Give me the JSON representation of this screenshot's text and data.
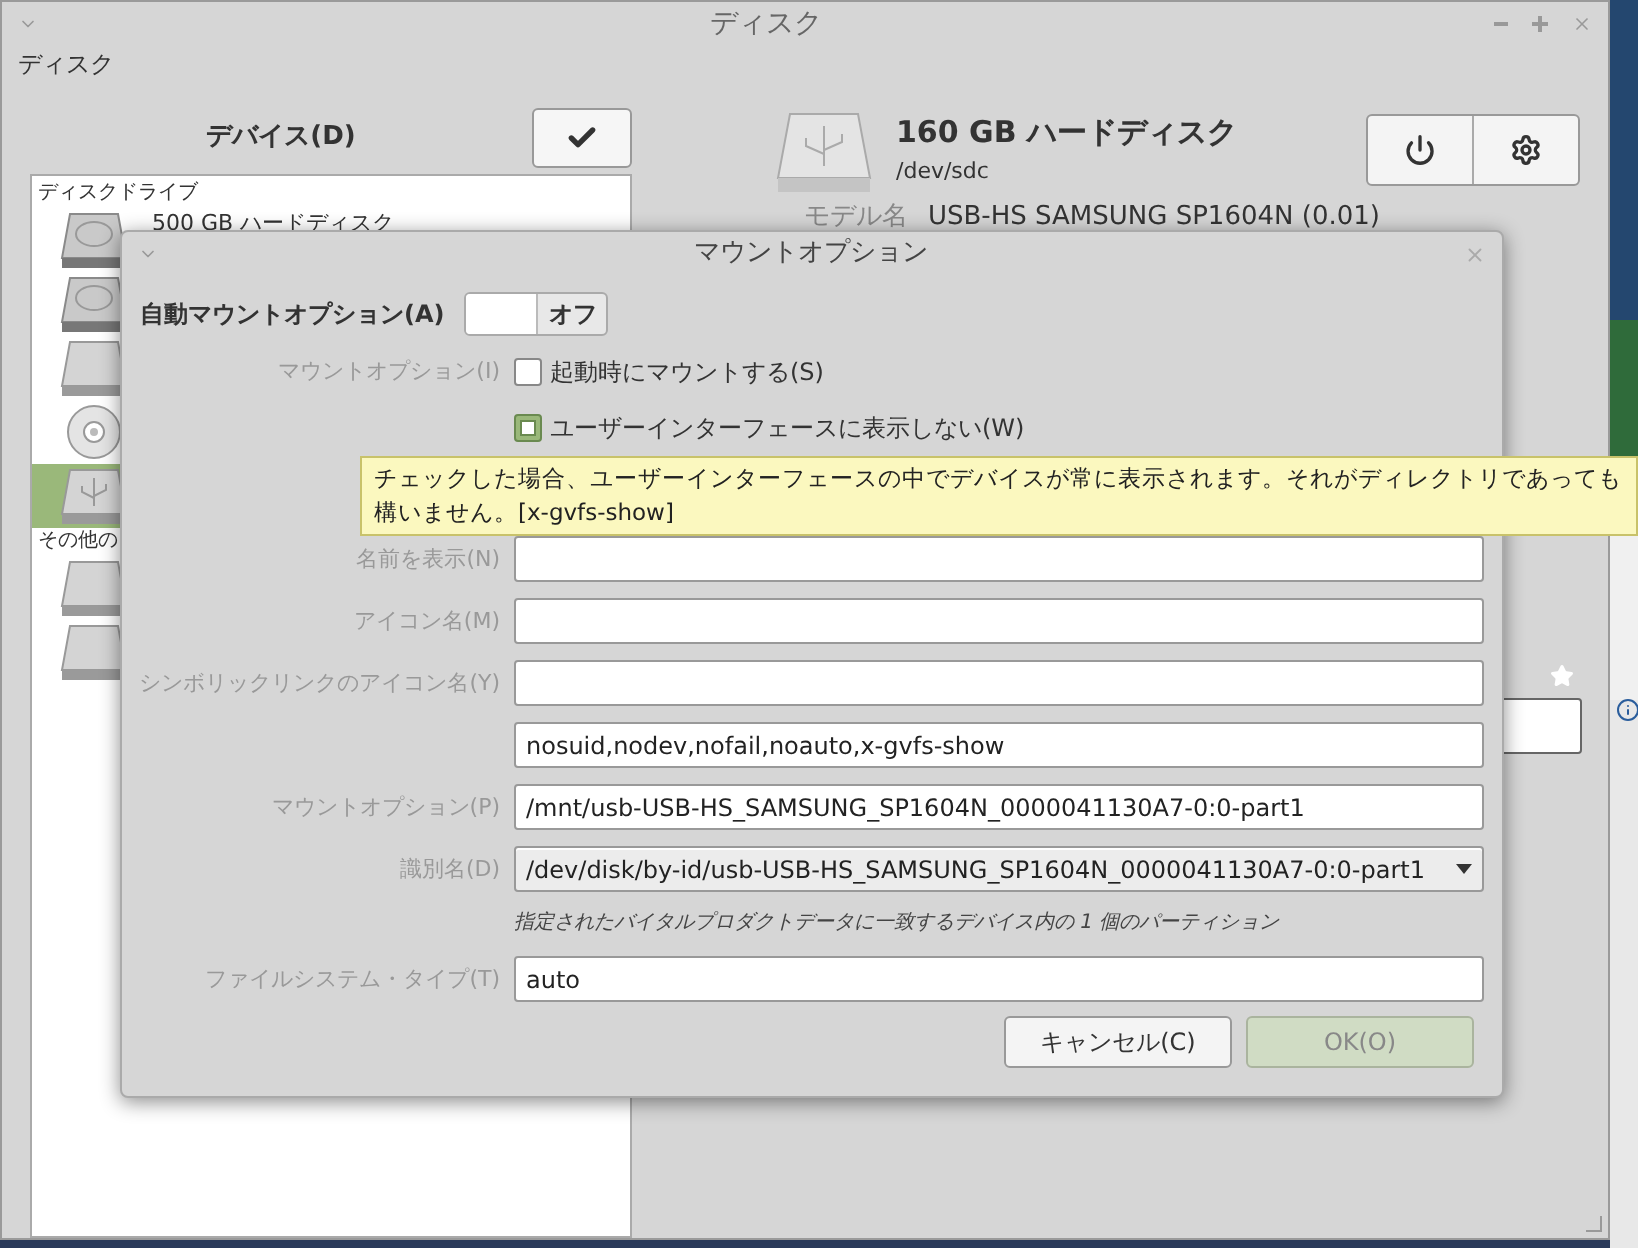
{
  "window": {
    "title": "ディスク"
  },
  "menu": [
    "ディスク"
  ],
  "devices": {
    "label": "デバイス(D)",
    "groups": [
      {
        "header": "ディスクドライブ",
        "items": [
          {
            "kind": "hdd",
            "label": "500 GB ハードディスク",
            "selected": false
          },
          {
            "kind": "hdd",
            "selected": false
          },
          {
            "kind": "drive",
            "selected": false
          },
          {
            "kind": "optical",
            "selected": false
          },
          {
            "kind": "usb",
            "selected": true
          }
        ]
      },
      {
        "header": "その他の",
        "items": [
          {
            "kind": "drive",
            "selected": false
          },
          {
            "kind": "drive",
            "selected": false
          }
        ]
      }
    ]
  },
  "disk": {
    "title": "160 GB ハードディスク",
    "path": "/dev/sdc",
    "model_label": "モデル名",
    "model": "USB-HS SAMSUNG SP1604N (0.01)"
  },
  "dialog": {
    "title": "マウントオプション",
    "auto_mount": {
      "label": "自動マウントオプション(A)",
      "on": false,
      "state_text": "オフ"
    },
    "options_label": "マウントオプション(I)",
    "checkboxes": [
      {
        "label": "起動時にマウントする(S)",
        "checked": false
      },
      {
        "label": "ユーザーインターフェースに表示しない(W)",
        "checked": true
      }
    ],
    "fields": [
      {
        "kind": "text",
        "label": "名前を表示(N)"
      },
      {
        "kind": "text",
        "label": "アイコン名(M)"
      },
      {
        "kind": "text",
        "label": "シンボリックリンクのアイコン名(Y)"
      },
      {
        "kind": "text",
        "value": "nosuid,nodev,nofail,noauto,x-gvfs-show"
      },
      {
        "kind": "text",
        "label": "マウントオプション(P)",
        "value": "/mnt/usb-USB-HS_SAMSUNG_SP1604N_0000041130A7-0:0-part1"
      },
      {
        "kind": "dropdown",
        "label": "識別名(D)",
        "value": "/dev/disk/by-id/usb-USB-HS_SAMSUNG_SP1604N_0000041130A7-0:0-part1",
        "hint": "指定されたバイタルプロダクトデータに一致するデバイス内の 1 個のパーティション"
      },
      {
        "kind": "text",
        "label": "ファイルシステム・タイプ(T)",
        "value": "auto"
      }
    ],
    "buttons": [
      {
        "label": "キャンセル(C)",
        "disabled": false
      },
      {
        "label": "OK(O)",
        "disabled": true
      }
    ]
  },
  "tooltip": {
    "text": "チェックした場合、ユーザーインターフェースの中でデバイスが常に表示されます。それがディレクトリであっても構いません。[x-gvfs-show]"
  }
}
